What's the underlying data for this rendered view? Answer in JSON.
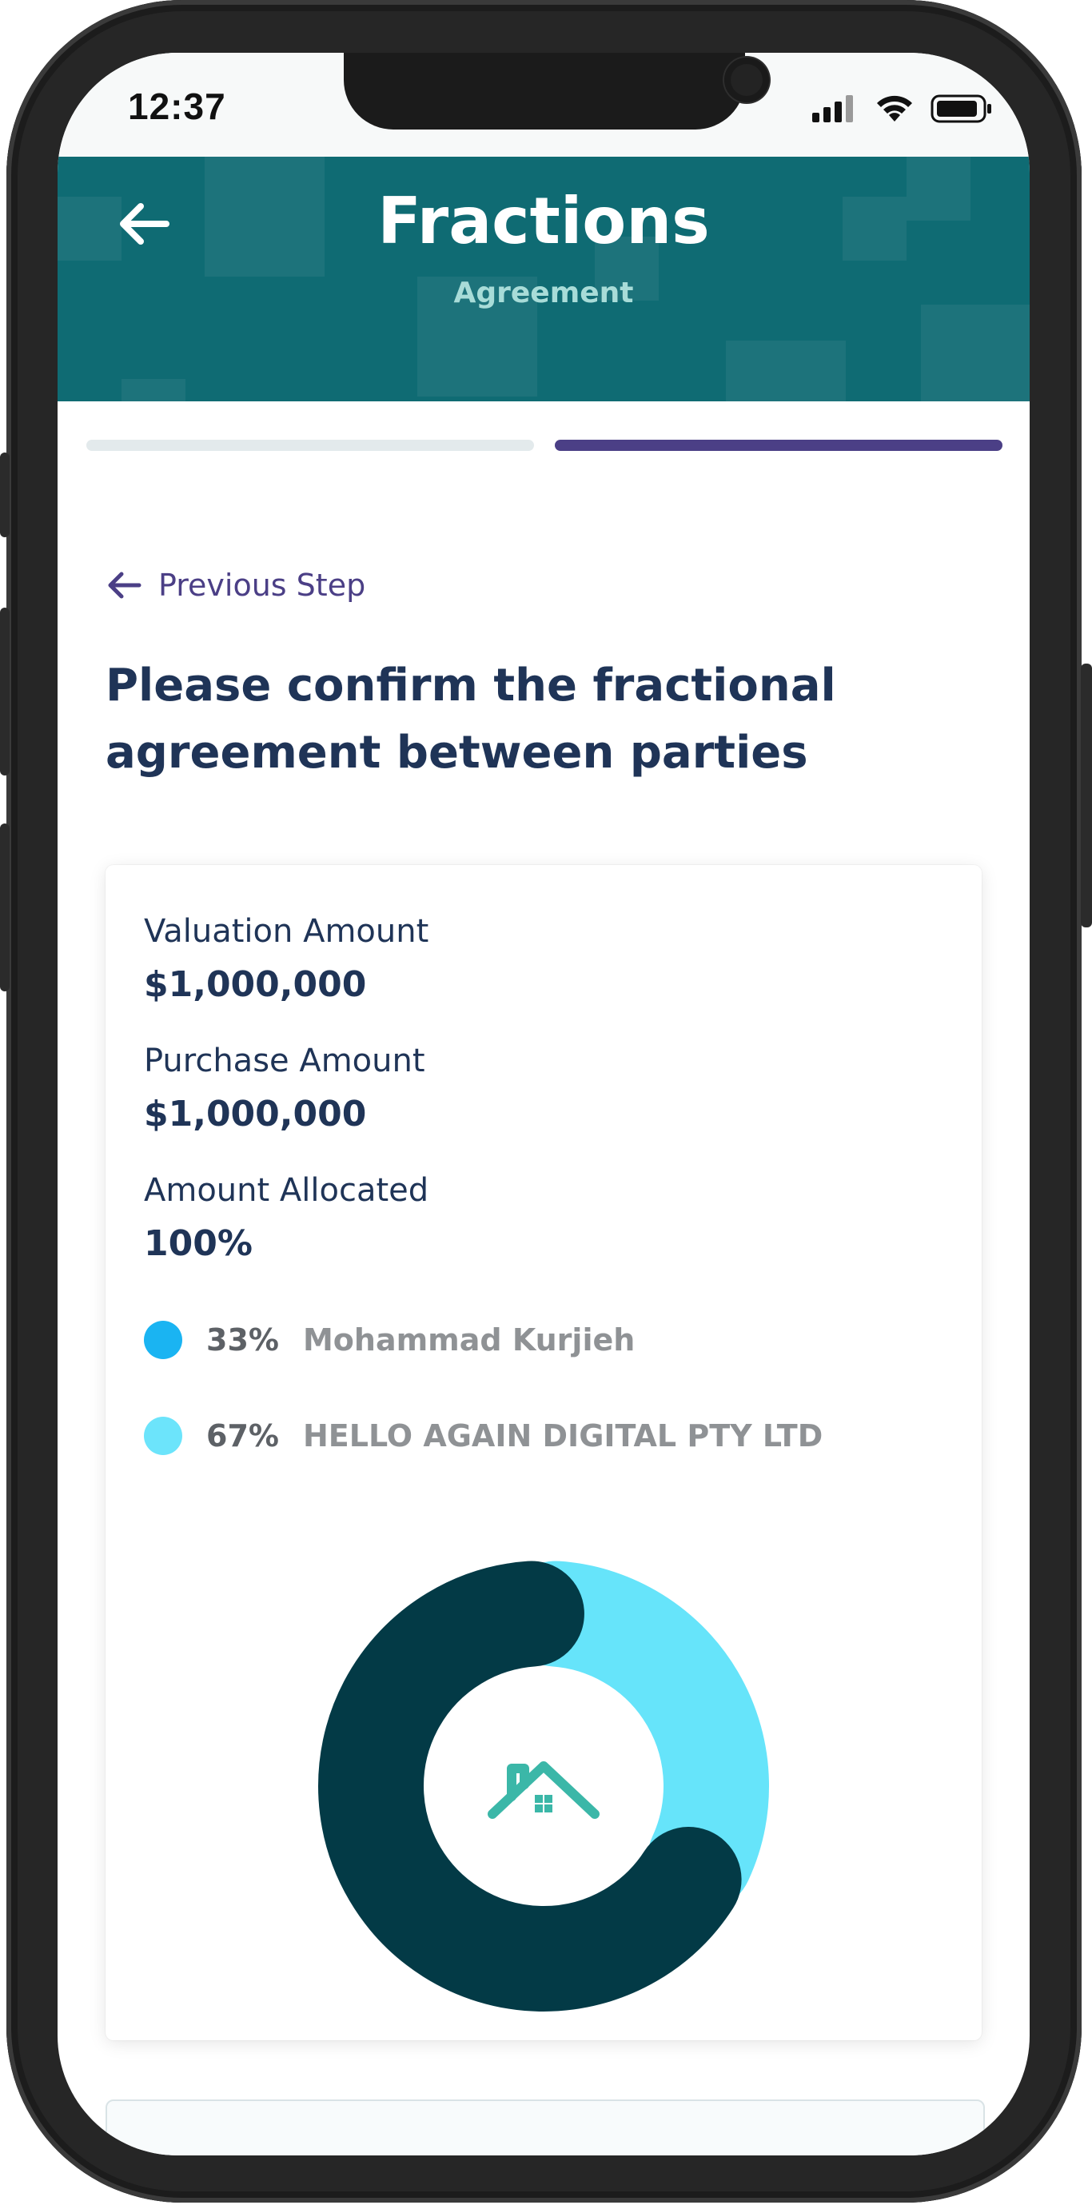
{
  "status_bar": {
    "time": "12:37",
    "icons": [
      "signal-icon",
      "wifi-icon",
      "battery-icon"
    ]
  },
  "header": {
    "title": "Fractions",
    "subtitle": "Agreement",
    "back_icon": "arrow-left-icon",
    "background_color": "#0f6b73"
  },
  "progress": {
    "steps": 2,
    "current_step": 2,
    "inactive_color": "#e3eaec",
    "active_color": "#4b3f86"
  },
  "previous_step": {
    "label": "Previous Step",
    "icon": "arrow-left-icon"
  },
  "heading": "Please confirm the fractional agreement between parties",
  "summary": {
    "valuation_label": "Valuation Amount",
    "valuation_value": "$1,000,000",
    "purchase_label": "Purchase Amount",
    "purchase_value": "$1,000,000",
    "allocated_label": "Amount Allocated",
    "allocated_value": "100%"
  },
  "owners": [
    {
      "percent": "33%",
      "name": "Mohammad Kurjieh",
      "color": "#1ab4f2"
    },
    {
      "percent": "67%",
      "name": "HELLO AGAIN DIGITAL PTY LTD",
      "color": "#6ce4fb"
    }
  ],
  "chart_data": {
    "type": "pie",
    "style": "donut",
    "center_icon": "house-icon",
    "slices": [
      {
        "label": "33%",
        "value": 33,
        "color": "#66e4fa"
      },
      {
        "label": "67%",
        "value": 67,
        "color": "#033a46"
      }
    ]
  }
}
